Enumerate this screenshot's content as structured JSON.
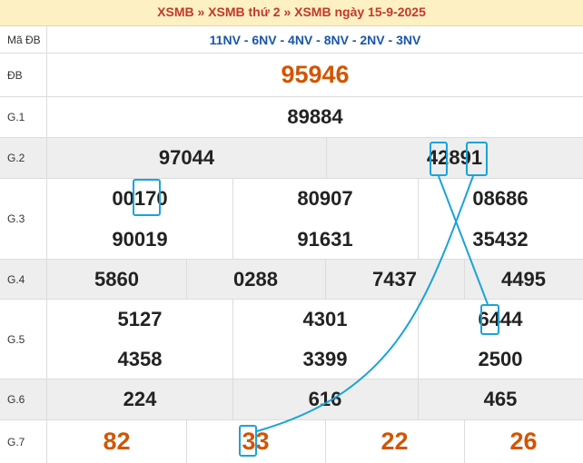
{
  "header": {
    "crumb1": "XSMB",
    "sep1": "»",
    "crumb2": "XSMB thứ 2",
    "sep2": "»",
    "crumb3": "XSMB ngày 15-9-2025"
  },
  "colors": {
    "accent_red": "#d35400",
    "code_blue": "#1a56a8",
    "highlight_blue": "#1ba3d8",
    "header_bg": "#fdf0c2"
  },
  "rows": {
    "ma_db": {
      "label": "Mã ĐB",
      "value": "11NV - 6NV - 4NV - 8NV - 2NV - 3NV"
    },
    "db": {
      "label": "ĐB",
      "value": "95946"
    },
    "g1": {
      "label": "G.1",
      "value": "89884"
    },
    "g2": {
      "label": "G.2",
      "values": [
        "97044",
        "42891"
      ]
    },
    "g3": {
      "label": "G.3",
      "values": [
        "00170",
        "80907",
        "08686",
        "90019",
        "91631",
        "35432"
      ]
    },
    "g4": {
      "label": "G.4",
      "values": [
        "5860",
        "0288",
        "7437",
        "4495"
      ]
    },
    "g5": {
      "label": "G.5",
      "values": [
        "5127",
        "4301",
        "6444",
        "4358",
        "3399",
        "2500"
      ]
    },
    "g6": {
      "label": "G.6",
      "values": [
        "224",
        "616",
        "465"
      ]
    },
    "g7": {
      "label": "G.7",
      "values": [
        "82",
        "33",
        "22",
        "26"
      ]
    }
  }
}
